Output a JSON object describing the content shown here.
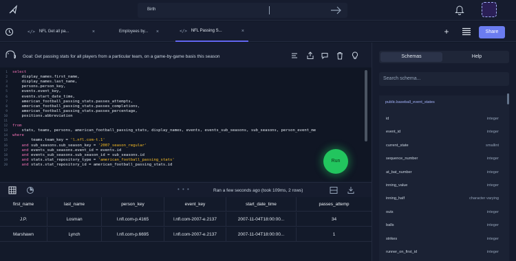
{
  "topbar": {
    "search_query": "Birth",
    "colors": {
      "accent": "#6b7cf0",
      "run": "#22c55e"
    }
  },
  "tabs": [
    {
      "label": "NFL Get all pa...",
      "active": false
    },
    {
      "label": "Employees by...",
      "active": false
    },
    {
      "label": "NFL Passing S...",
      "active": true
    }
  ],
  "tab_code_glyph": "</>",
  "tab_close_glyph": "×",
  "toolbar": {
    "new_tab_glyph": "+",
    "share_label": "Share"
  },
  "editor": {
    "goal": "Goal: Get passing stats for all players from a particular team, on a game-by-game basis this season",
    "lines": [
      {
        "n": "1",
        "parts": [
          [
            "kw",
            "select"
          ]
        ]
      },
      {
        "n": "2",
        "parts": [
          [
            "tx",
            "    display_names.first_name,"
          ]
        ]
      },
      {
        "n": "3",
        "parts": [
          [
            "tx",
            "    display_names.last_name,"
          ]
        ]
      },
      {
        "n": "4",
        "parts": [
          [
            "tx",
            "    persons.person_key,"
          ]
        ]
      },
      {
        "n": "5",
        "parts": [
          [
            "tx",
            "    events.event_key,"
          ]
        ]
      },
      {
        "n": "6",
        "parts": [
          [
            "tx",
            "    events.start_date_time,"
          ]
        ]
      },
      {
        "n": "7",
        "parts": [
          [
            "tx",
            "    american_football_passing_stats.passes_attempts,"
          ]
        ]
      },
      {
        "n": "8",
        "parts": [
          [
            "tx",
            "    american_football_passing_stats.passes_completions,"
          ]
        ]
      },
      {
        "n": "9",
        "parts": [
          [
            "tx",
            "    american_football_passing_stats.passes_percentage,"
          ]
        ]
      },
      {
        "n": "10",
        "parts": [
          [
            "tx",
            "    positions.abbreviation"
          ]
        ]
      },
      {
        "n": "11",
        "parts": [
          [
            "tx",
            ""
          ]
        ]
      },
      {
        "n": "12",
        "parts": [
          [
            "kw",
            "from"
          ]
        ]
      },
      {
        "n": "13",
        "parts": [
          [
            "tx",
            "    stats, teams, persons, american_football_passing_stats, display_names, events, events_sub_seasons, sub_seasons, person_event_me"
          ]
        ]
      },
      {
        "n": "14",
        "parts": [
          [
            "kw",
            "where"
          ]
        ]
      },
      {
        "n": "15",
        "parts": [
          [
            "tx",
            "        teams.team_key = "
          ],
          [
            "st",
            "'l.nfl.com-t.1'"
          ]
        ]
      },
      {
        "n": "16",
        "parts": [
          [
            "kw",
            "    and "
          ],
          [
            "tx",
            "sub_seasons.sub_season_key = "
          ],
          [
            "st",
            "'2007_season_regular'"
          ]
        ]
      },
      {
        "n": "17",
        "parts": [
          [
            "kw",
            "    and "
          ],
          [
            "tx",
            "events_sub_seasons.event_id = events.id"
          ]
        ]
      },
      {
        "n": "18",
        "parts": [
          [
            "kw",
            "    and "
          ],
          [
            "tx",
            "events_sub_seasons.sub_season_id = sub_seasons.id"
          ]
        ]
      },
      {
        "n": "19",
        "parts": [
          [
            "kw",
            "    and "
          ],
          [
            "tx",
            "stats.stat_repository_type = "
          ],
          [
            "st",
            "'american_football_passing_stats'"
          ]
        ]
      },
      {
        "n": "20",
        "parts": [
          [
            "kw",
            "    and "
          ],
          [
            "tx",
            "stats.stat_repository_id = american_football_passing_stats.id"
          ]
        ]
      }
    ],
    "run_label": "Run"
  },
  "results": {
    "run_info": "Ran a few seconds ago (took 109ms, 2 rows)",
    "dots": "• • •",
    "columns": [
      "first_name",
      "last_name",
      "person_key",
      "event_key",
      "start_date_time",
      "passes_attemp"
    ],
    "rows": [
      [
        "J.P.",
        "Losman",
        "l.nfl.com-p.4165",
        "l.nfl.com-2007-e.2137",
        "2007-11-04T18:00:00...",
        "34"
      ],
      [
        "Marshawn",
        "Lynch",
        "l.nfl.com-p.6695",
        "l.nfl.com-2007-e.2137",
        "2007-11-04T18:00:00...",
        "1"
      ]
    ]
  },
  "right_panel": {
    "tabs": [
      {
        "label": "Schemas",
        "active": true
      },
      {
        "label": "Help",
        "active": false
      }
    ],
    "search_placeholder": "Search schema...",
    "schema_title": "public.baseball_event_states",
    "fields": [
      {
        "name": "id",
        "type": "integer"
      },
      {
        "name": "event_id",
        "type": "integer"
      },
      {
        "name": "current_state",
        "type": "smallint"
      },
      {
        "name": "sequence_number",
        "type": "integer"
      },
      {
        "name": "at_bat_number",
        "type": "integer"
      },
      {
        "name": "inning_value",
        "type": "integer"
      },
      {
        "name": "inning_half",
        "type": "character varying"
      },
      {
        "name": "outs",
        "type": "integer"
      },
      {
        "name": "balls",
        "type": "integer"
      },
      {
        "name": "strikes",
        "type": "integer"
      },
      {
        "name": "runner_on_first_id",
        "type": "integer"
      }
    ]
  }
}
